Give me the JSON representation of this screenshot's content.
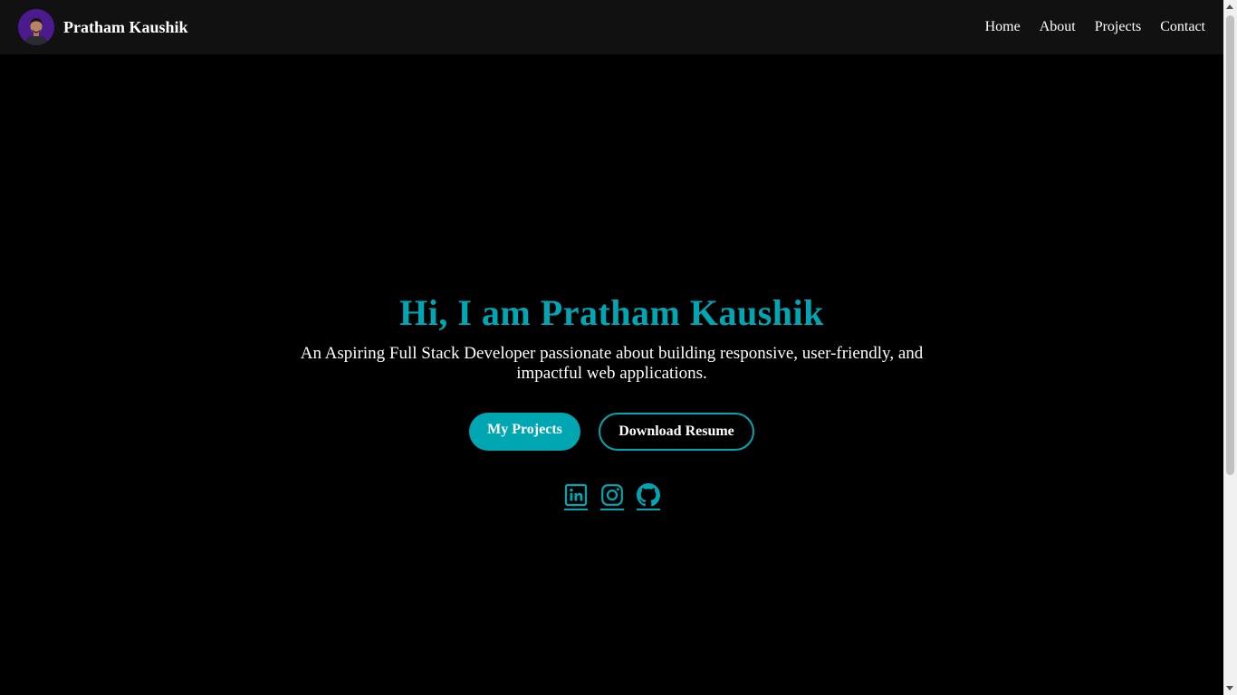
{
  "navbar": {
    "brand_name": "Pratham Kaushik",
    "links": [
      "Home",
      "About",
      "Projects",
      "Contact"
    ]
  },
  "hero": {
    "title": "Hi, I am Pratham Kaushik",
    "subtitle": "An Aspiring Full Stack Developer passionate about building responsive, user-friendly, and impactful web applications.",
    "primary_button": "My Projects",
    "secondary_button": "Download Resume",
    "social_icons": [
      "linkedin-icon",
      "instagram-icon",
      "github-icon"
    ]
  },
  "colors": {
    "accent": "#00a6b2",
    "background": "#000000",
    "navbar": "#111111",
    "text": "#ffffff"
  }
}
